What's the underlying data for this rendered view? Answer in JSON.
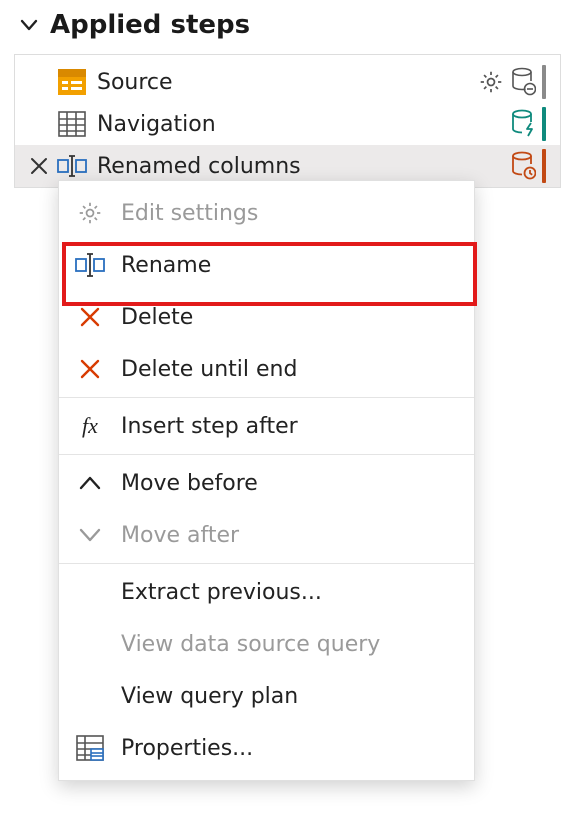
{
  "header": {
    "title": "Applied steps"
  },
  "steps": [
    {
      "label": "Source",
      "icon": "source-icon",
      "gear": true,
      "db": "db-minus",
      "bar": "#8a8a8a"
    },
    {
      "label": "Navigation",
      "icon": "table-icon",
      "gear": false,
      "db": "db-bolt",
      "bar": "#0f7a6f"
    },
    {
      "label": "Renamed columns",
      "icon": "rename-icon",
      "gear": false,
      "db": "db-clock",
      "bar": "#c24914",
      "selected": true,
      "delete": true
    }
  ],
  "menu": [
    {
      "label": "Edit settings",
      "icon": "gear-icon",
      "disabled": true
    },
    {
      "label": "Rename",
      "icon": "rename-icon",
      "highlight": true
    },
    {
      "label": "Delete",
      "icon": "x-red-icon"
    },
    {
      "label": "Delete until end",
      "icon": "x-red-icon",
      "sepAfter": true
    },
    {
      "label": "Insert step after",
      "icon": "fx-icon",
      "sepAfter": true
    },
    {
      "label": "Move before",
      "icon": "chevron-up-icon"
    },
    {
      "label": "Move after",
      "icon": "chevron-down-icon",
      "disabled": true,
      "sepAfter": true
    },
    {
      "label": "Extract previous...",
      "icon": ""
    },
    {
      "label": "View data source query",
      "icon": "",
      "disabled": true
    },
    {
      "label": "View query plan",
      "icon": ""
    },
    {
      "label": "Properties...",
      "icon": "properties-icon"
    }
  ]
}
